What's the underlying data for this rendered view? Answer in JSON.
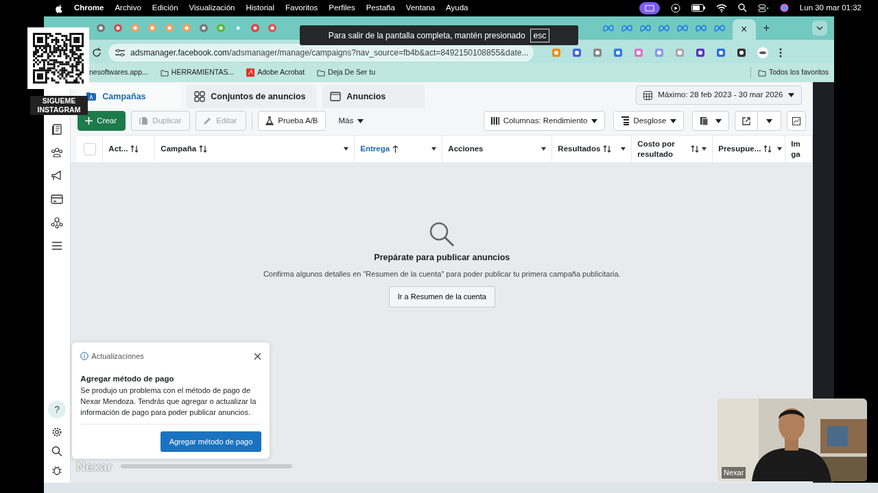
{
  "menu_bar": {
    "app": "Chrome",
    "items": [
      "Archivo",
      "Edición",
      "Visualización",
      "Historial",
      "Favoritos",
      "Perfiles",
      "Pestaña",
      "Ventana",
      "Ayuda"
    ],
    "clock": "Lun 30 mar  01:32"
  },
  "browser": {
    "close_tab": "×",
    "new_tab": "+",
    "address": {
      "domain": "adsmanager.facebook.com",
      "path": "/adsmanager/manage/campaigns?nav_source=fb4b&act=8492150108855&date..."
    },
    "bookmarks": [
      {
        "label": "nesoftwares.app...",
        "kind": "page"
      },
      {
        "label": "HERRAMIENTAS...",
        "kind": "folder"
      },
      {
        "label": "Adobe Acrobat",
        "kind": "pdf"
      },
      {
        "label": "Deja De Ser tu",
        "kind": "folder"
      }
    ],
    "all_bookmarks": "Todos los favoritos"
  },
  "fullscreen_toast": {
    "text": "Para salir de la pantalla completa, mantén presionado",
    "key": "esc"
  },
  "overlay": {
    "caption": "SIGUEME INSTAGRAM",
    "name": "Nexar"
  },
  "sidebar": {
    "items": [
      {
        "selected": false
      },
      {
        "selected": false
      },
      {
        "selected": false
      },
      {
        "selected": false
      },
      {
        "selected": false
      },
      {
        "selected": false
      }
    ],
    "help": "?"
  },
  "level_tabs": [
    {
      "label": "Campañas",
      "selected": true
    },
    {
      "label": "Conjuntos de anuncios",
      "selected": false
    },
    {
      "label": "Anuncios",
      "selected": false
    }
  ],
  "date_range": "Máximo: 28 feb 2023 - 30 mar 2026",
  "toolbar": [
    {
      "label": "Crear",
      "kind": "primary",
      "disabled": false
    },
    {
      "label": "Duplicar",
      "kind": "duplicate",
      "disabled": true
    },
    {
      "label": "Editar",
      "kind": "edit",
      "disabled": true
    },
    {
      "label": "Prueba A/B",
      "kind": "test",
      "disabled": false
    },
    {
      "label": "Más",
      "kind": "menu",
      "disabled": false
    }
  ],
  "view_buttons": [
    "Columnas: Rendimiento",
    "Desglose"
  ],
  "table": {
    "columns": [
      {
        "label": "Act...",
        "sortable": true,
        "sorted": false,
        "menu": false
      },
      {
        "label": "Campaña",
        "sortable": true,
        "sorted": false,
        "menu": true
      },
      {
        "label": "Entrega",
        "sortable": false,
        "sorted": true,
        "menu": true
      },
      {
        "label": "Acciones",
        "sortable": false,
        "sorted": false,
        "menu": true
      },
      {
        "label": "Resultados",
        "sortable": true,
        "sorted": false,
        "menu": true
      },
      {
        "label": "Costo por resultado",
        "sortable": true,
        "sorted": false,
        "menu": true
      },
      {
        "label": "Presupue...",
        "sortable": true,
        "sorted": false,
        "menu": true
      },
      {
        "label": "Im ga",
        "sortable": false,
        "sorted": false,
        "menu": false
      }
    ],
    "select_all": {
      "checked": false
    }
  },
  "empty_state": {
    "title": "Prepárate para publicar anuncios",
    "text": "Confirma algunos detalles en \"Resumen de la cuenta\" para poder publicar tu primera campaña publicitaria.",
    "button": "Ir a Resumen de la cuenta"
  },
  "notification": {
    "header": "Actualizaciones",
    "title": "Agregar método de pago",
    "text": "Se produjo un problema con el método de pago de Nexar Mendoza. Tendrás que agregar o actualizar la información de pago para poder publicar anuncios.",
    "button": "Agregar método de pago"
  },
  "webcam": {
    "name": "Nexar"
  }
}
